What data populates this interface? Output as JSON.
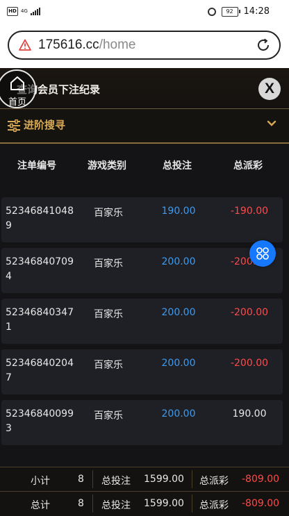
{
  "status_bar": {
    "hd_label": "HD",
    "network": "4G",
    "battery": "92",
    "time": "14:28"
  },
  "address_bar": {
    "domain": "175616.cc",
    "path": "/home"
  },
  "header": {
    "title": "查询会员下注纪录",
    "home_label": "首页",
    "close_label": "X"
  },
  "advanced_search": {
    "label": "进阶搜寻"
  },
  "table": {
    "columns": [
      "注单编号",
      "游戏类别",
      "总投注",
      "总派彩"
    ],
    "rows": [
      {
        "id": "523468410489",
        "game": "百家乐",
        "bet": "190.00",
        "payout": "-190.00",
        "payout_color": "#ff4a4a"
      },
      {
        "id": "523468407094",
        "game": "百家乐",
        "bet": "200.00",
        "payout": "-200.00",
        "payout_color": "#ff4a4a"
      },
      {
        "id": "523468403471",
        "game": "百家乐",
        "bet": "200.00",
        "payout": "-200.00",
        "payout_color": "#ff4a4a"
      },
      {
        "id": "523468402047",
        "game": "百家乐",
        "bet": "200.00",
        "payout": "-200.00",
        "payout_color": "#ff4a4a"
      },
      {
        "id": "523468400993",
        "game": "百家乐",
        "bet": "200.00",
        "payout": "190.00",
        "payout_color": "#e8e8e8"
      }
    ]
  },
  "summary": {
    "subtotal": {
      "label": "小计",
      "count": "8",
      "bet_label": "总投注",
      "bet": "1599.00",
      "payout_label": "总派彩",
      "payout": "-809.00"
    },
    "total": {
      "label": "总计",
      "count": "8",
      "bet_label": "总投注",
      "bet": "1599.00",
      "payout_label": "总派彩",
      "payout": "-809.00"
    }
  },
  "colors": {
    "accent_gold": "#d9a954",
    "bet_blue": "#3d9bf0",
    "negative_red": "#ff4a4a",
    "fab_blue": "#1677ff"
  },
  "icons": {
    "fab": "grid-icon",
    "home": "home-icon",
    "filter": "filter-icon",
    "chevron": "chevron-down-icon"
  }
}
